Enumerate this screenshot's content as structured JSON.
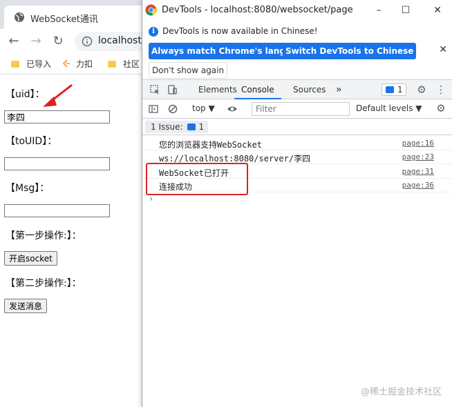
{
  "browser": {
    "tab_title": "WebSocket通讯",
    "address": "localhost:",
    "bookmarks": [
      "已导入",
      "力扣",
      "社区"
    ]
  },
  "page": {
    "uid_label": "【uid】：",
    "uid_value": "李四",
    "touid_label": "【toUID】：",
    "touid_value": "",
    "msg_label": "【Msg】：",
    "msg_value": "",
    "step1_label": "【第一步操作:】：",
    "open_socket_button": "开启socket",
    "step2_label": "【第二步操作:】：",
    "send_button": "发送消息"
  },
  "devtools": {
    "title": "DevTools - localhost:8080/websocket/page",
    "window_controls": [
      "–",
      "☐",
      "✕"
    ],
    "infobar": {
      "message": "DevTools is now available in Chinese!",
      "match_button": "Always match Chrome's language",
      "switch_button": "Switch DevTools to Chinese",
      "dont_show_button": "Don't show again",
      "close": "✕"
    },
    "tabs": [
      "Elements",
      "Console",
      "Sources"
    ],
    "active_tab": "Console",
    "more_tabs": "»",
    "issues_badge_count": "1",
    "context_select": "top ▼",
    "filter_placeholder": "Filter",
    "levels_select": "Default levels ▼",
    "issues_pill": {
      "label": "1 Issue:",
      "count": "1"
    },
    "console_logs": [
      {
        "message": "您的浏览器支持WebSocket",
        "source": "page:16"
      },
      {
        "message": "ws://localhost:8080/server/李四",
        "source": "page:23"
      },
      {
        "message": "WebSocket已打开",
        "source": "page:31"
      },
      {
        "message": "连接成功",
        "source": "page:36"
      }
    ],
    "prompt_glyph": "›"
  },
  "watermark": "@稀土掘金技术社区",
  "colors": {
    "accent": "#1a73e8",
    "highlight": "#e02020",
    "tabbar": "#dee1e6"
  }
}
